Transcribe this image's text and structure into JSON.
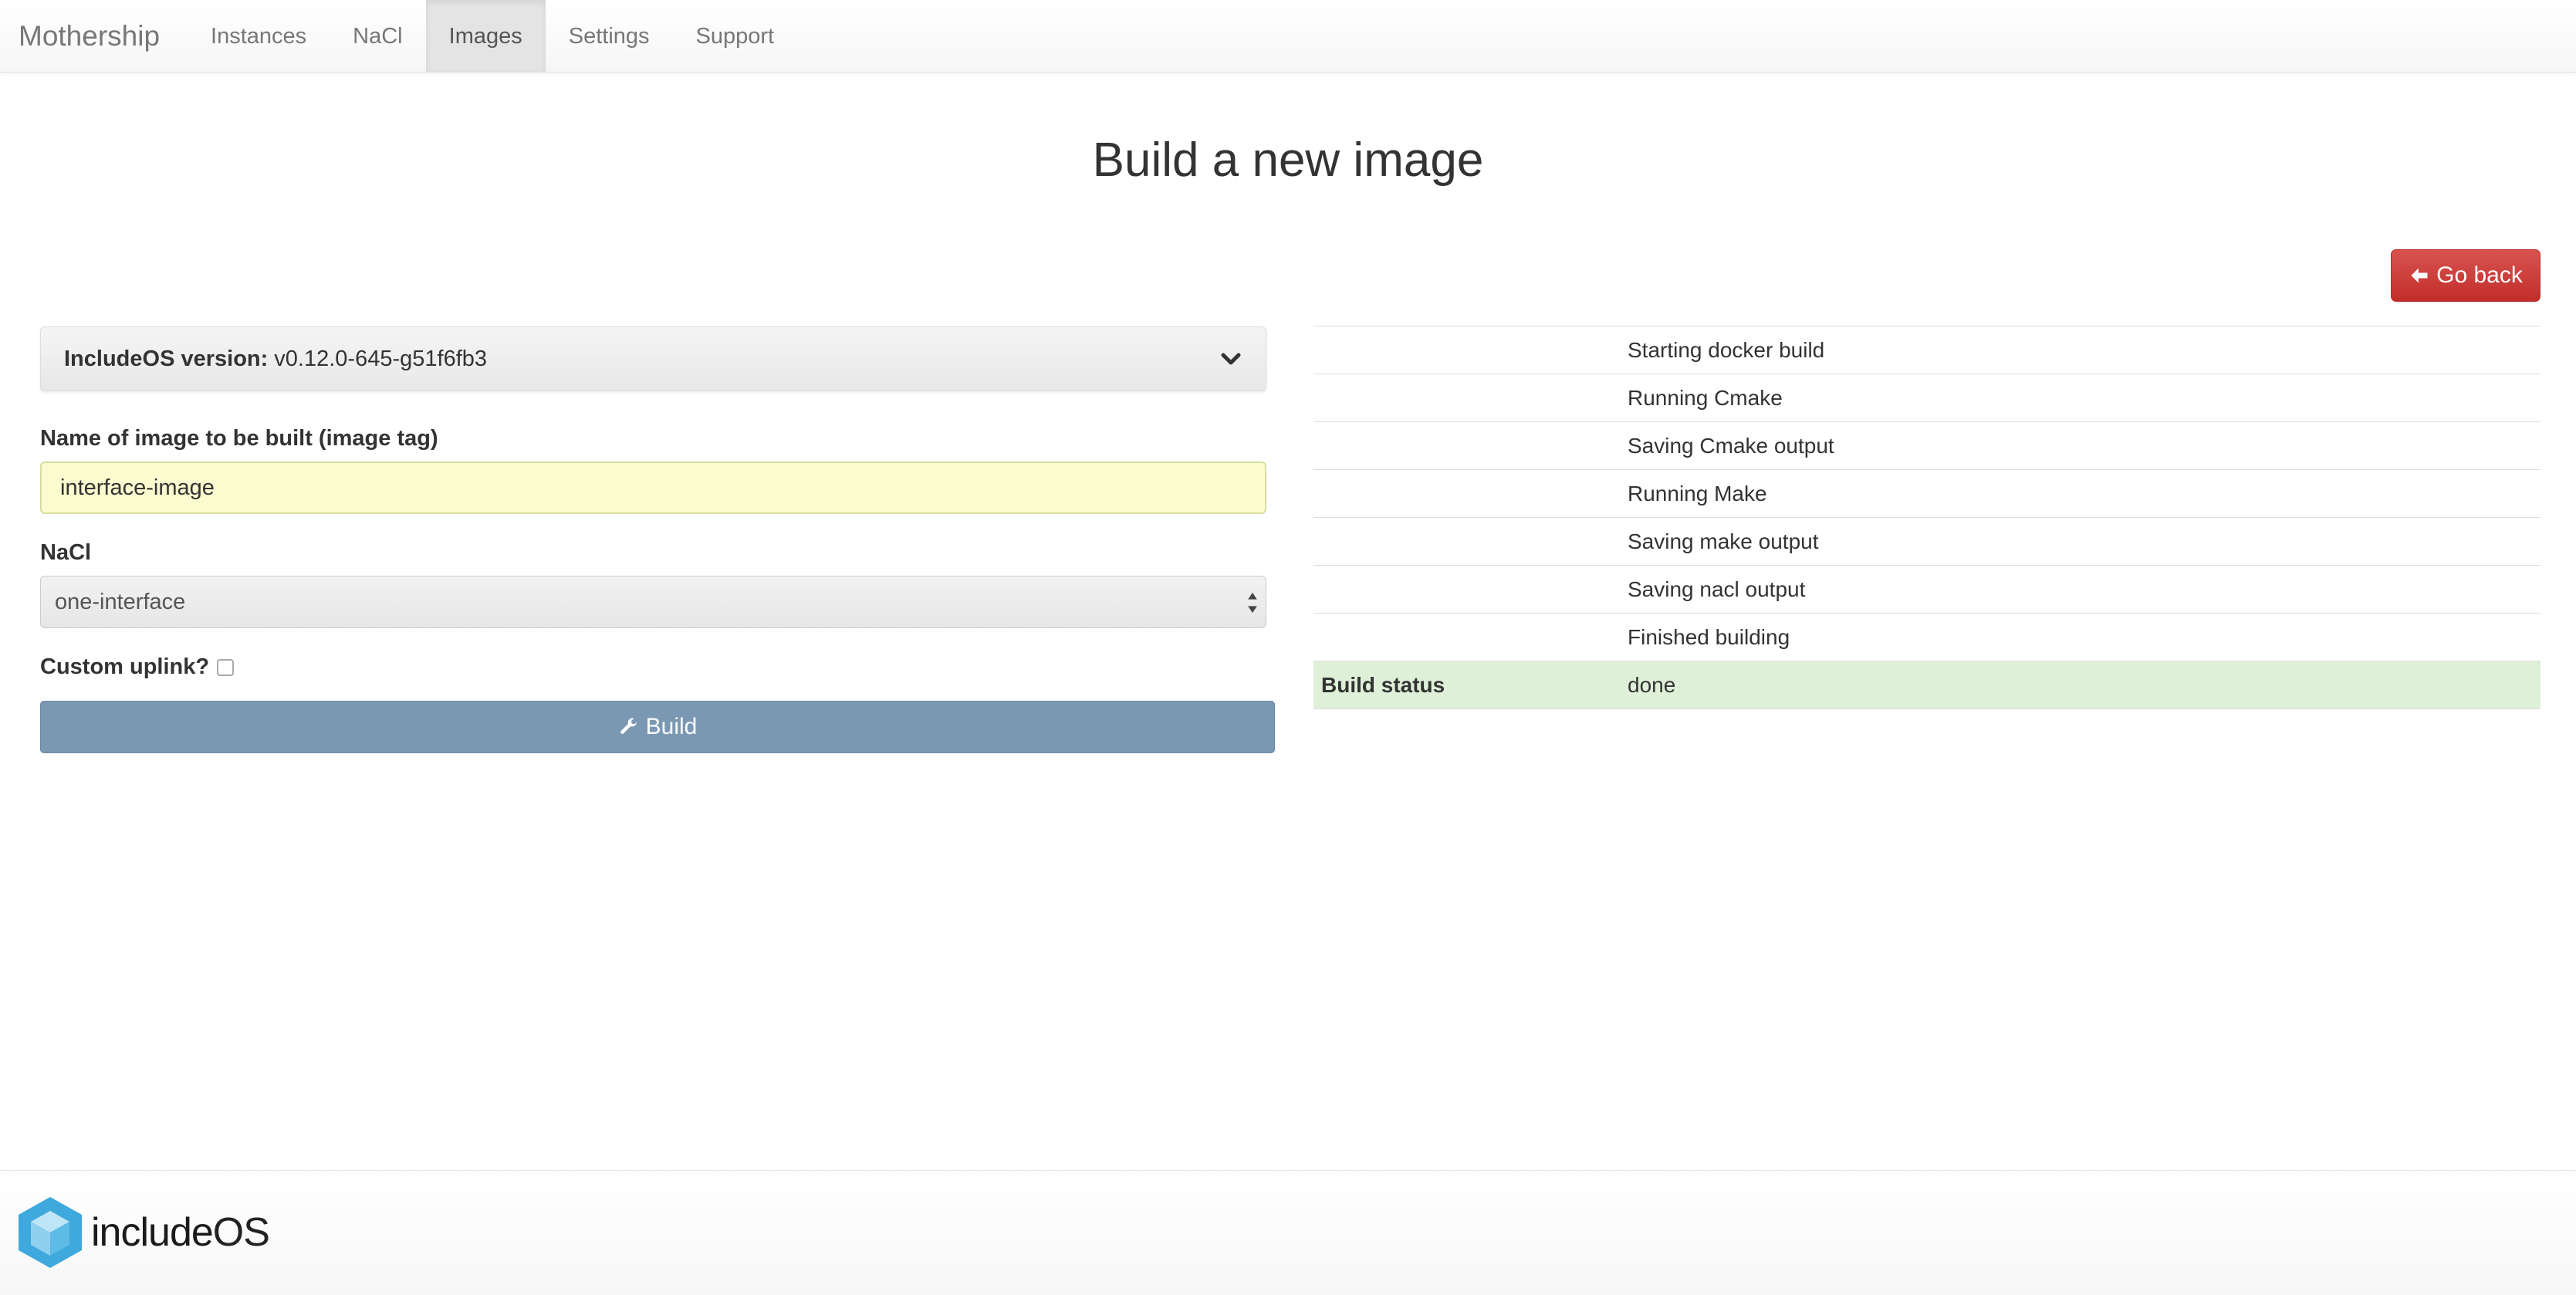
{
  "navbar": {
    "brand": "Mothership",
    "items": [
      {
        "label": "Instances"
      },
      {
        "label": "NaCl"
      },
      {
        "label": "Images"
      },
      {
        "label": "Settings"
      },
      {
        "label": "Support"
      }
    ],
    "active_item": "Images"
  },
  "page": {
    "title": "Build a new image",
    "go_back_label": "Go back"
  },
  "form": {
    "version_label": "IncludeOS version:",
    "version_value": "v0.12.0-645-g51f6fb3",
    "image_name_label": "Name of image to be built (image tag)",
    "image_name_value": "interface-image",
    "nacl_label": "NaCl",
    "nacl_selected": "one-interface",
    "custom_uplink_label": "Custom uplink?",
    "custom_uplink_checked": false,
    "build_label": "Build"
  },
  "build_log": {
    "steps": [
      {
        "label": "",
        "value": "Starting docker build"
      },
      {
        "label": "",
        "value": "Running Cmake"
      },
      {
        "label": "",
        "value": "Saving Cmake output"
      },
      {
        "label": "",
        "value": "Running Make"
      },
      {
        "label": "",
        "value": "Saving make output"
      },
      {
        "label": "",
        "value": "Saving nacl output"
      },
      {
        "label": "",
        "value": "Finished building"
      }
    ],
    "status": {
      "label": "Build status",
      "value": "done"
    }
  },
  "footer": {
    "logo_text_include": "include",
    "logo_text_os": "OS"
  },
  "colors": {
    "danger": "#d9534f",
    "build_button": "#7b98b3",
    "success_row": "#dff0d8",
    "input_autofill": "#fafcd0",
    "logo_blue": "#3fa9dd"
  },
  "icons": {
    "go_back": "arrow-left-icon",
    "build": "wrench-icon",
    "version_toggle": "chevron-down-icon",
    "select": "select-arrows-icon",
    "logo": "includeos-cube-logo"
  }
}
